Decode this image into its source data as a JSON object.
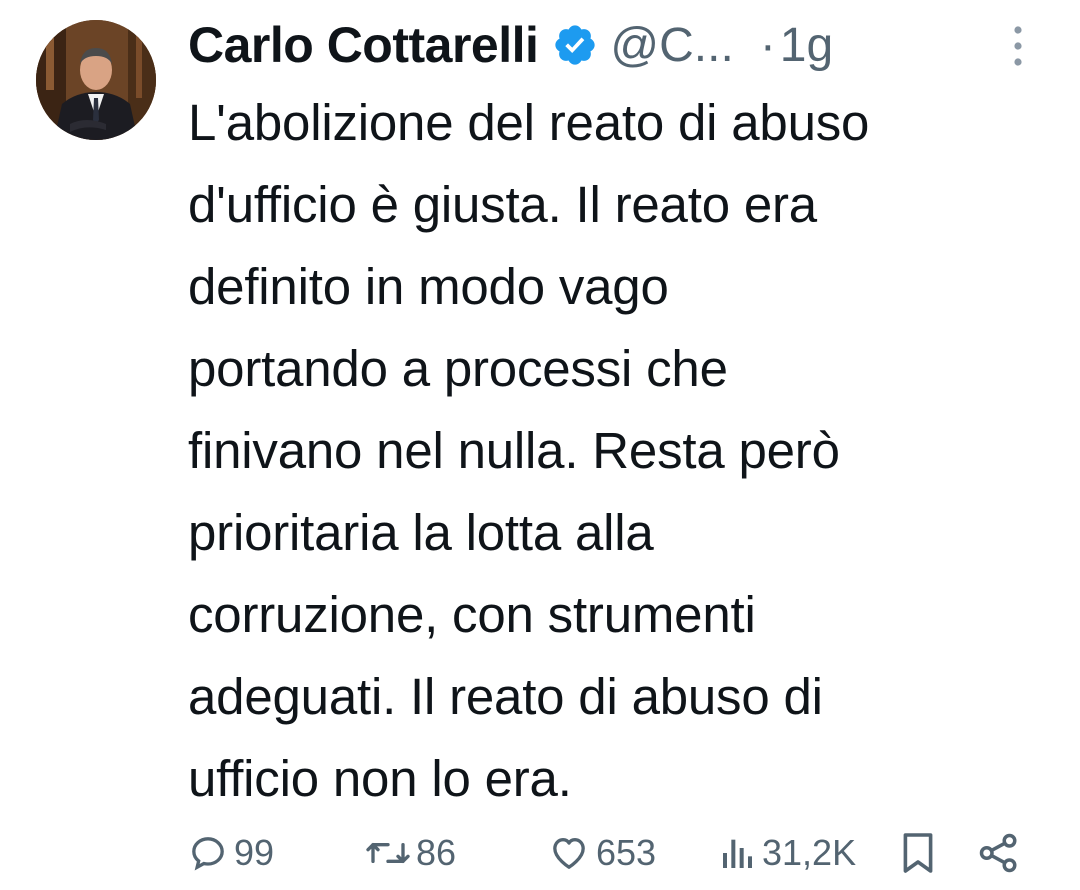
{
  "author": {
    "name": "Carlo Cottarelli",
    "handle": "@C...",
    "separator": "·",
    "time": "1g"
  },
  "tweet": {
    "text": "L'abolizione del reato di abuso\nd'ufficio è giusta. Il reato era\ndefinito in modo vago\nportando a processi che\nfinivano nel nulla. Resta però\nprioritaria la lotta alla\ncorruzione, con strumenti\nadeguati. Il reato di abuso di\nufficio non lo era."
  },
  "actions": {
    "replies": "99",
    "reposts": "86",
    "likes": "653",
    "views": "31,2K"
  },
  "icons": {
    "verified": "verified-badge-icon",
    "more": "more-vertical-icon",
    "reply": "reply-icon",
    "repost": "repost-icon",
    "like": "heart-icon",
    "views": "views-icon",
    "bookmark": "bookmark-icon",
    "share": "share-icon"
  },
  "colors": {
    "verified": "#1d9bf0",
    "muted": "#536471",
    "text": "#0f1419"
  }
}
